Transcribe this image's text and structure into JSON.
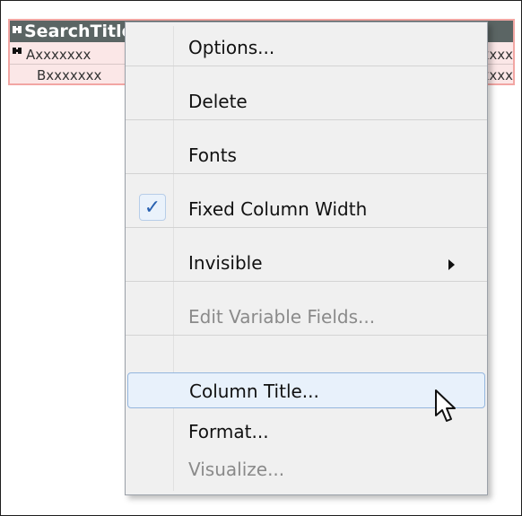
{
  "panel": {
    "title": "SearchTitle",
    "row1": {
      "left": "Axxxxxxx",
      "right": "xxxx"
    },
    "row2": {
      "left": "Bxxxxxxx",
      "right": "xxxx"
    }
  },
  "menu": {
    "items": [
      {
        "label": "Options...",
        "checked": false,
        "disabled": false
      },
      {
        "label": "Delete",
        "checked": false,
        "disabled": false
      },
      {
        "label": "Fonts",
        "checked": false,
        "disabled": false
      },
      {
        "label": "Fixed Column Width",
        "checked": true,
        "disabled": false
      },
      {
        "label": "Invisible",
        "checked": false,
        "disabled": false,
        "submenu": true
      },
      {
        "label": "Edit Variable Fields...",
        "checked": false,
        "disabled": true
      },
      {
        "label": "Column Title...",
        "checked": false,
        "disabled": false,
        "hovered": true
      },
      {
        "label": "Format...",
        "checked": false,
        "disabled": false
      },
      {
        "label": "Visualize...",
        "checked": false,
        "disabled": true
      }
    ],
    "checkmark_glyph": "✓"
  },
  "colors": {
    "title_bar": "#5b6564",
    "panel_border": "#f2a6a3",
    "panel_bg": "#fbe7e7",
    "menu_bg": "#f0f0f0",
    "highlight_border": "#94b6de",
    "check_color": "#2860b0"
  },
  "icons": {
    "header_icon": "search-binoculars-icon",
    "row_icon": "search-binoculars-icon",
    "cursor": "mouse-pointer-icon",
    "submenu": "chevron-right-icon"
  }
}
